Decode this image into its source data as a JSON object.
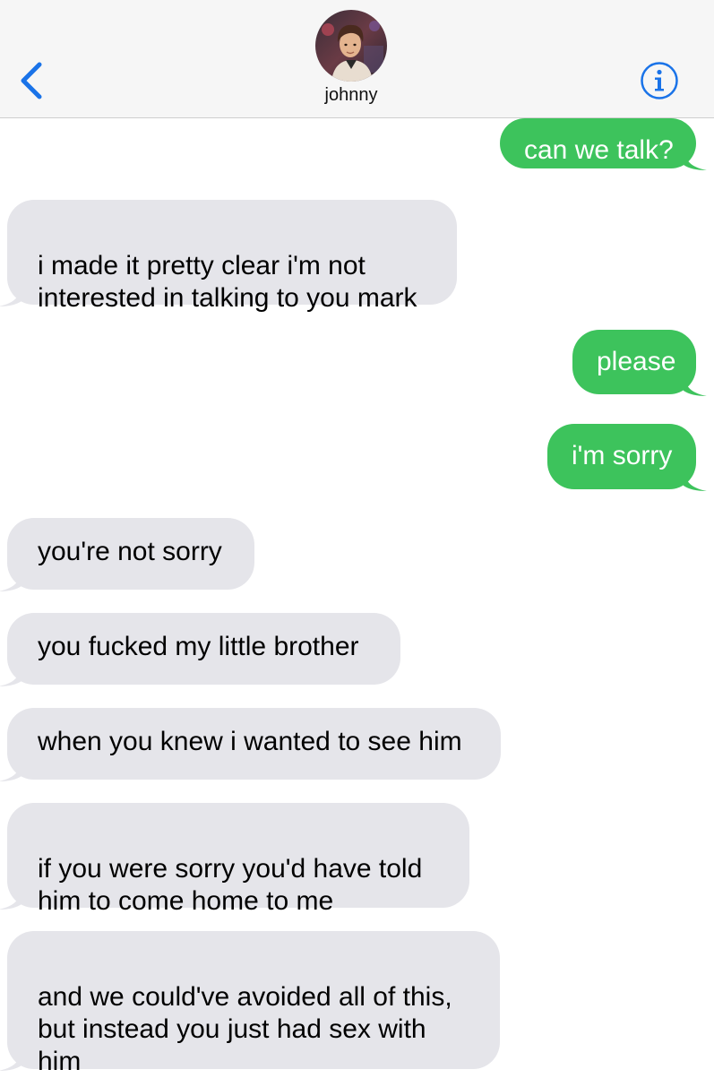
{
  "header": {
    "back_icon": "chevron-left-icon",
    "contact_name": "johnny",
    "info_icon": "info-circle-icon",
    "accent_color": "#1a73e8"
  },
  "messages": [
    {
      "dir": "out",
      "text": "can we talk?"
    },
    {
      "dir": "in",
      "text": "i made it pretty clear i'm not\ninterested in talking to you mark"
    },
    {
      "dir": "out",
      "text": "please"
    },
    {
      "dir": "out",
      "text": "i'm sorry"
    },
    {
      "dir": "in",
      "text": "you're not sorry"
    },
    {
      "dir": "in",
      "text": "you fucked my little brother"
    },
    {
      "dir": "in",
      "text": "when you knew i wanted to see him"
    },
    {
      "dir": "in",
      "text": "if you were sorry you'd have told\nhim to come home to me"
    },
    {
      "dir": "in",
      "text": "and we could've avoided all of this,\nbut instead you just had sex with\nhim"
    }
  ],
  "colors": {
    "incoming_bubble": "#e5e5ea",
    "outgoing_bubble": "#3dc35c",
    "header_bg": "#f6f6f6"
  }
}
